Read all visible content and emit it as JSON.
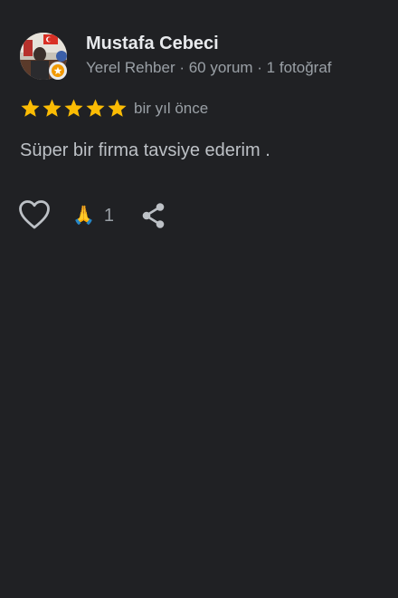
{
  "review": {
    "author_name": "Mustafa Cebeci",
    "author_meta": "Yerel Rehber · 60 yorum · 1 fotoğraf",
    "rating": 5,
    "date": "bir yıl önce",
    "text": "Süper bir firma tavsiye ederim .",
    "reaction_emoji": "🙏",
    "reaction_count": "1"
  },
  "icons": {
    "like": "heart-outline-icon",
    "share": "share-icon",
    "badge": "local-guide-badge-icon"
  },
  "colors": {
    "background": "#202124",
    "star": "#fbbc04",
    "name": "#e8eaed",
    "meta": "#9aa0a6",
    "text": "#bdc1c6",
    "icon": "#bdc1c6"
  }
}
